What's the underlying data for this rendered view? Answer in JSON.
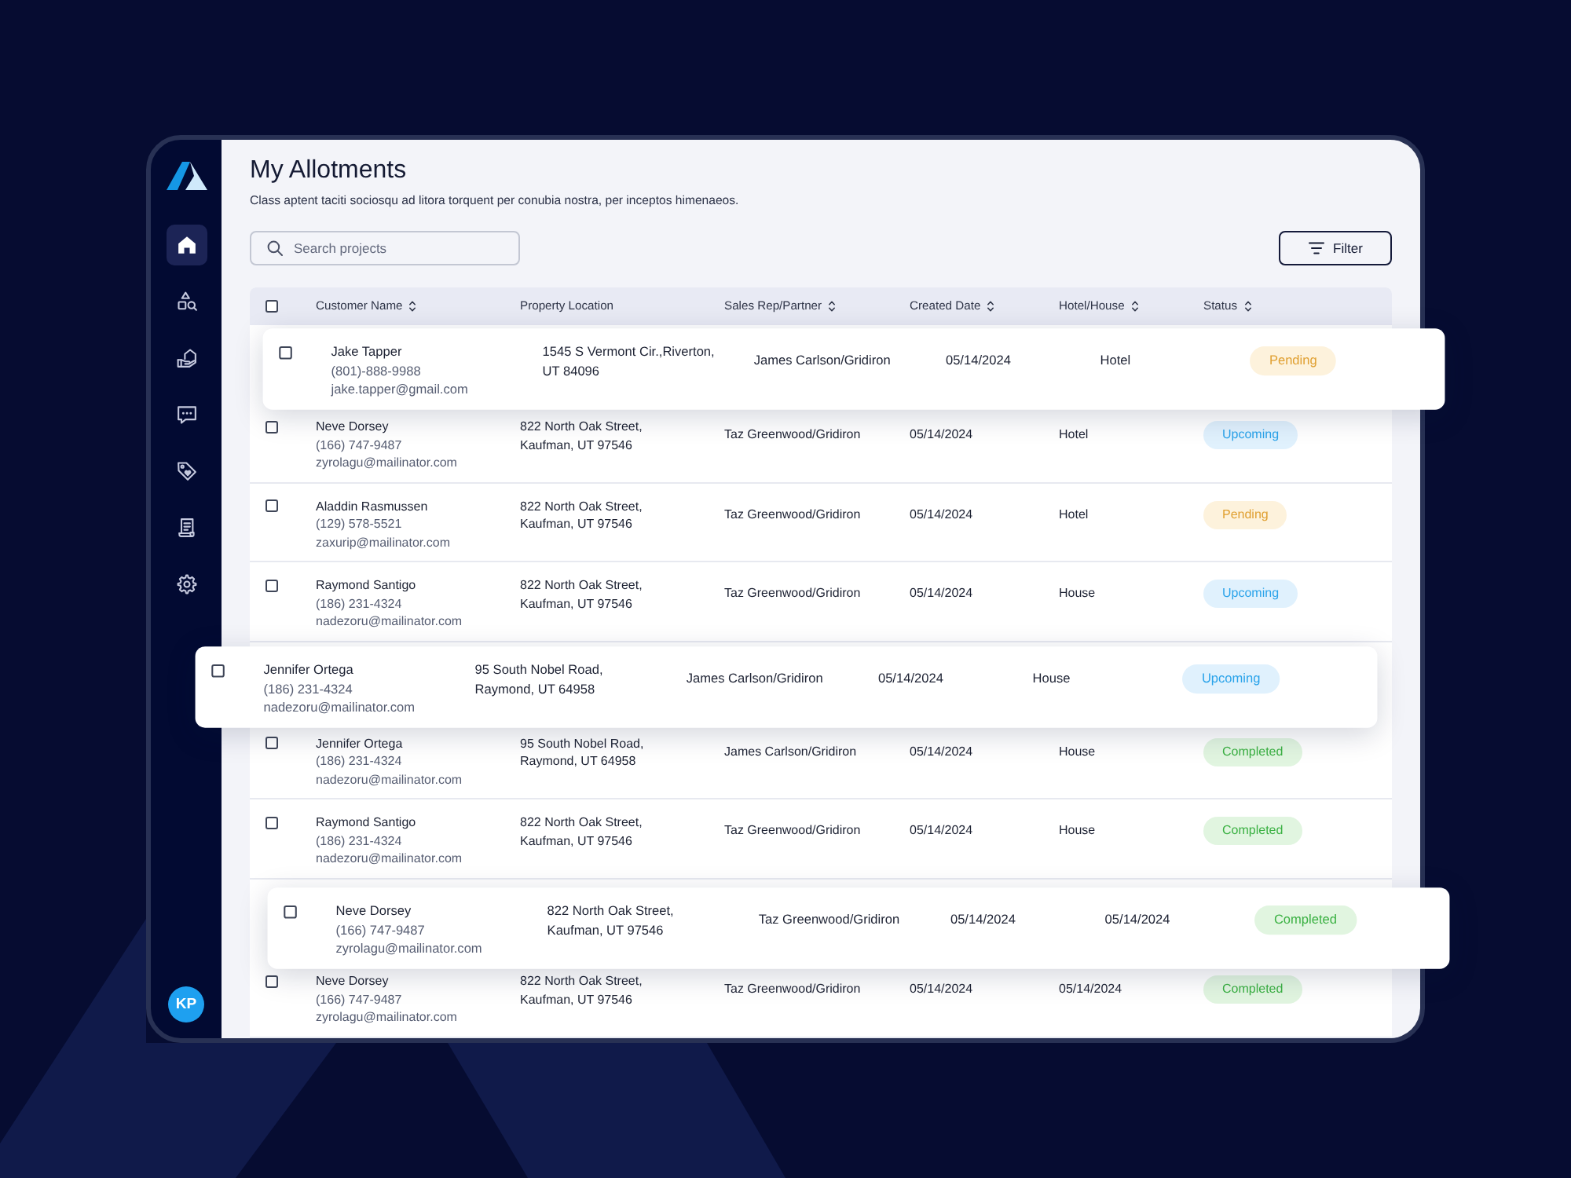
{
  "sidebar": {
    "items": [
      {
        "kind": "home",
        "selected": true
      },
      {
        "kind": "catalog",
        "selected": false
      },
      {
        "kind": "properties",
        "selected": false
      },
      {
        "kind": "messages",
        "selected": false
      },
      {
        "kind": "offers",
        "selected": false
      },
      {
        "kind": "documents",
        "selected": false
      },
      {
        "kind": "settings",
        "selected": false
      }
    ],
    "avatar": {
      "initials": "KP"
    }
  },
  "header": {
    "title": "My Allotments",
    "subtitle": "Class aptent taciti sociosqu ad litora torquent per conubia nostra, per inceptos himenaeos."
  },
  "search": {
    "placeholder": "Search projects"
  },
  "filter_button": {
    "label": "Filter"
  },
  "table": {
    "select_all": {
      "checked": false
    },
    "columns": [
      {
        "label": "Customer Name",
        "sortable": true
      },
      {
        "label": "Property Location",
        "sortable": false
      },
      {
        "label": "Sales Rep/Partner",
        "sortable": true
      },
      {
        "label": "Created Date",
        "sortable": true
      },
      {
        "label": "Hotel/House",
        "sortable": true
      },
      {
        "label": "Status",
        "sortable": true
      }
    ],
    "rows": [
      {
        "checked": false,
        "raised": true,
        "name": "Jake Tapper",
        "phone": "(801)-888-9988",
        "email": "jake.tapper@gmail.com",
        "location": "1545 S Vermont Cir.,Riverton,\nUT 84096",
        "sales_rep": "James Carlson/Gridiron",
        "created": "05/14/2024",
        "hotel_house": "Hotel",
        "status": {
          "label": "Pending",
          "kind": "pending"
        }
      },
      {
        "checked": false,
        "raised": false,
        "name": "Neve Dorsey",
        "phone": "(166) 747-9487",
        "email": "zyrolagu@mailinator.com",
        "location": "822 North Oak Street,\nKaufman, UT 97546",
        "sales_rep": "Taz Greenwood/Gridiron",
        "created": "05/14/2024",
        "hotel_house": "Hotel",
        "status": {
          "label": "Upcoming",
          "kind": "upcoming"
        }
      },
      {
        "checked": false,
        "raised": false,
        "name": "Aladdin Rasmussen",
        "phone": "(129) 578-5521",
        "email": "zaxurip@mailinator.com",
        "location": "822 North Oak Street,\nKaufman, UT 97546",
        "sales_rep": "Taz Greenwood/Gridiron",
        "created": "05/14/2024",
        "hotel_house": "Hotel",
        "status": {
          "label": "Pending",
          "kind": "pending"
        }
      },
      {
        "checked": false,
        "raised": false,
        "name": "Raymond Santigo",
        "phone": "(186) 231-4324",
        "email": "nadezoru@mailinator.com",
        "location": "822 North Oak Street,\nKaufman, UT 97546",
        "sales_rep": "Taz Greenwood/Gridiron",
        "created": "05/14/2024",
        "hotel_house": "House",
        "status": {
          "label": "Upcoming",
          "kind": "upcoming"
        }
      },
      {
        "checked": false,
        "raised": true,
        "name": "Jennifer Ortega",
        "phone": "(186) 231-4324",
        "email": "nadezoru@mailinator.com",
        "location": "95 South Nobel Road,\nRaymond, UT 64958",
        "sales_rep": "James Carlson/Gridiron",
        "created": "05/14/2024",
        "hotel_house": "House",
        "status": {
          "label": "Upcoming",
          "kind": "upcoming"
        }
      },
      {
        "checked": false,
        "raised": false,
        "name": "Jennifer Ortega",
        "phone": "(186) 231-4324",
        "email": "nadezoru@mailinator.com",
        "location": "95 South Nobel Road,\nRaymond, UT 64958",
        "sales_rep": "James Carlson/Gridiron",
        "created": "05/14/2024",
        "hotel_house": "House",
        "status": {
          "label": "Completed",
          "kind": "completed"
        }
      },
      {
        "checked": false,
        "raised": false,
        "name": "Raymond Santigo",
        "phone": "(186) 231-4324",
        "email": "nadezoru@mailinator.com",
        "location": "822 North Oak Street,\nKaufman, UT 97546",
        "sales_rep": "Taz Greenwood/Gridiron",
        "created": "05/14/2024",
        "hotel_house": "House",
        "status": {
          "label": "Completed",
          "kind": "completed"
        }
      },
      {
        "checked": false,
        "raised": true,
        "name": "Neve Dorsey",
        "phone": "(166) 747-9487",
        "email": "zyrolagu@mailinator.com",
        "location": "822 North Oak Street,\nKaufman, UT 97546",
        "sales_rep": "Taz Greenwood/Gridiron",
        "created": "05/14/2024",
        "hotel_house": "05/14/2024",
        "status": {
          "label": "Completed",
          "kind": "completed"
        }
      },
      {
        "checked": false,
        "raised": false,
        "name": "Neve Dorsey",
        "phone": "(166) 747-9487",
        "email": "zyrolagu@mailinator.com",
        "location": "822 North Oak Street,\nKaufman, UT 97546",
        "sales_rep": "Taz Greenwood/Gridiron",
        "created": "05/14/2024",
        "hotel_house": "05/14/2024",
        "status": {
          "label": "Completed",
          "kind": "completed"
        }
      }
    ]
  }
}
